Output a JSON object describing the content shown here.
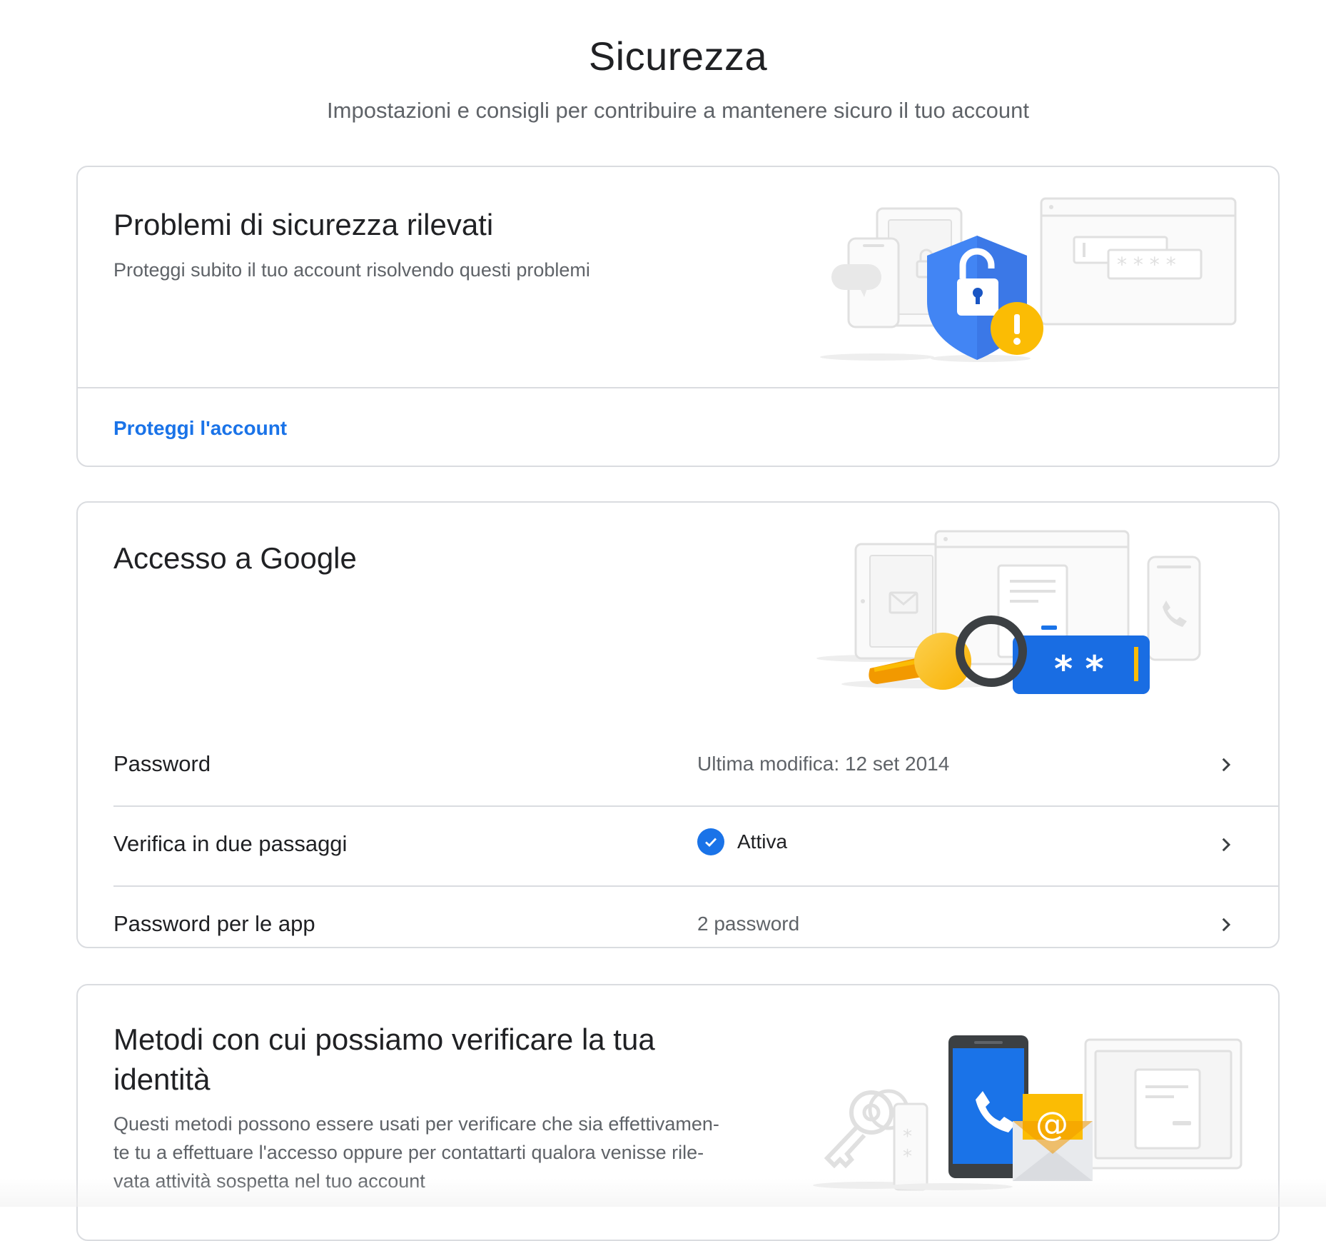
{
  "header": {
    "title": "Sicurezza",
    "subtitle": "Impostazioni e consigli per contribuire a mantenere sicuro il tuo account"
  },
  "issues_card": {
    "title": "Problemi di sicurezza rilevati",
    "description": "Proteggi subito il tuo account risolvendo questi problemi",
    "link_label": "Proteggi l'account"
  },
  "signin_card": {
    "title": "Accesso a Google",
    "rows": [
      {
        "label": "Password",
        "value": "Ultima modifica: 12 set 2014"
      },
      {
        "label": "Verifica in due passaggi",
        "value": "Attiva"
      },
      {
        "label": "Password per le app",
        "value": "2 password"
      }
    ]
  },
  "verify_card": {
    "title_line1": "Metodi con cui possiamo verificare la tua",
    "title_line2": "identità",
    "description_line1": "Questi metodi possono essere usati per verificare che sia effettivamen-",
    "description_line2": "te tu a effettuare l'accesso oppure per contattarti qualora venisse rile-",
    "description_line3": "vata attività sospetta nel tuo account"
  },
  "colors": {
    "accent_blue": "#1a73e8",
    "warning_yellow": "#fbbc04",
    "border": "#dadce0",
    "text_secondary": "#5f6368"
  }
}
